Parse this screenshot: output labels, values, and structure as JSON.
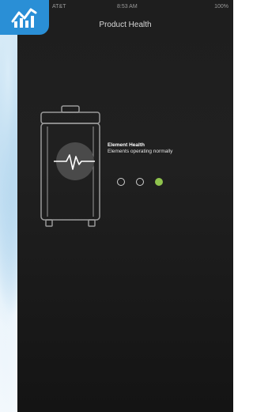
{
  "header": {
    "title": "Product Health"
  },
  "status_bar": {
    "carrier": "AT&T",
    "time": "8:53 AM",
    "battery": "100%"
  },
  "element_health": {
    "title": "Element Health",
    "subtitle": "Elements operating normally"
  },
  "indicators": [
    {
      "state": "inactive"
    },
    {
      "state": "inactive"
    },
    {
      "state": "active"
    }
  ],
  "colors": {
    "brand_badge": "#2a8fd6",
    "background": "#1e1e1e",
    "active_indicator": "#8fc34d"
  },
  "icons": {
    "logo": "chart-growth-icon",
    "device": "water-filter-device-icon",
    "pulse": "heartbeat-pulse-icon"
  }
}
